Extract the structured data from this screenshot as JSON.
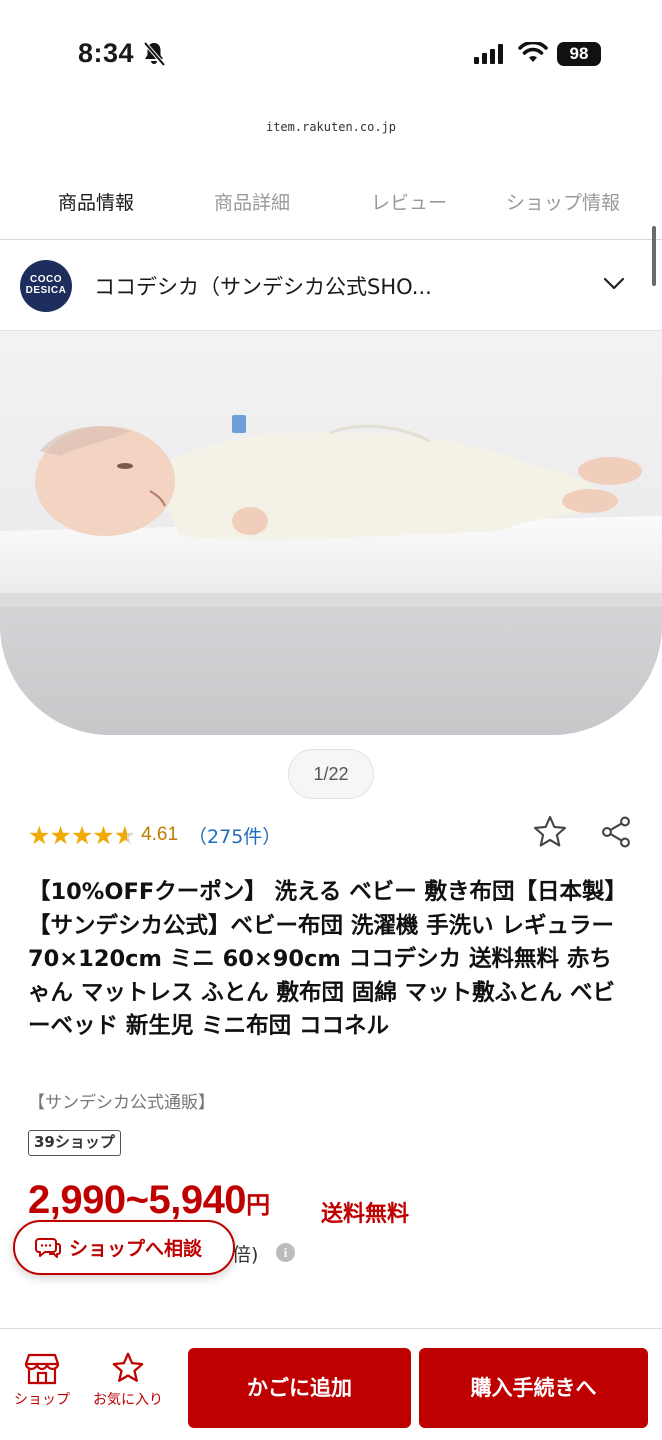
{
  "status_bar": {
    "time": "8:34",
    "battery": "98",
    "icons": [
      "bell-off-icon",
      "signal-icon",
      "wifi-icon",
      "battery-icon"
    ]
  },
  "browser": {
    "url": "item.rakuten.co.jp"
  },
  "tabs": [
    {
      "label": "商品情報",
      "active": true
    },
    {
      "label": "商品詳細",
      "active": false
    },
    {
      "label": "レビュー",
      "active": false
    },
    {
      "label": "ショップ情報",
      "active": false
    }
  ],
  "shop": {
    "logo_line1": "COCO",
    "logo_line2": "DESICA",
    "name": "ココデシカ（サンデシカ公式SHO..."
  },
  "gallery": {
    "pager": "1/22",
    "current": 1,
    "total": 22
  },
  "rating": {
    "value": 4.61,
    "value_text": "4.61",
    "max": 5,
    "count_text": "（275件）"
  },
  "product": {
    "title": "【10%OFFクーポン】 洗える ベビー 敷き布団【日本製】【サンデシカ公式】ベビー布団 洗濯機 手洗い レギュラー70×120cm ミニ 60×90cm ココデシカ 送料無料 赤ちゃん マットレス ふとん 敷布団 固綿 マット敷ふとん ベビーベッド 新生児 ミニ布団 ココネル",
    "shop_tag": "【サンデシカ公式通販】",
    "badge": "39ショップ",
    "price": "2,990~5,940",
    "price_unit": "円",
    "shipping": "送料無料",
    "points_fragment": "倍)"
  },
  "floating": {
    "consult_label": "ショップへ相談"
  },
  "bottom_bar": {
    "shop_label": "ショップ",
    "favorite_label": "お気に入り",
    "cart_button": "かごに追加",
    "buy_button": "購入手続きへ"
  },
  "colors": {
    "brand_red": "#bf0000",
    "star": "#f2a900",
    "link": "#1f6cbf"
  }
}
